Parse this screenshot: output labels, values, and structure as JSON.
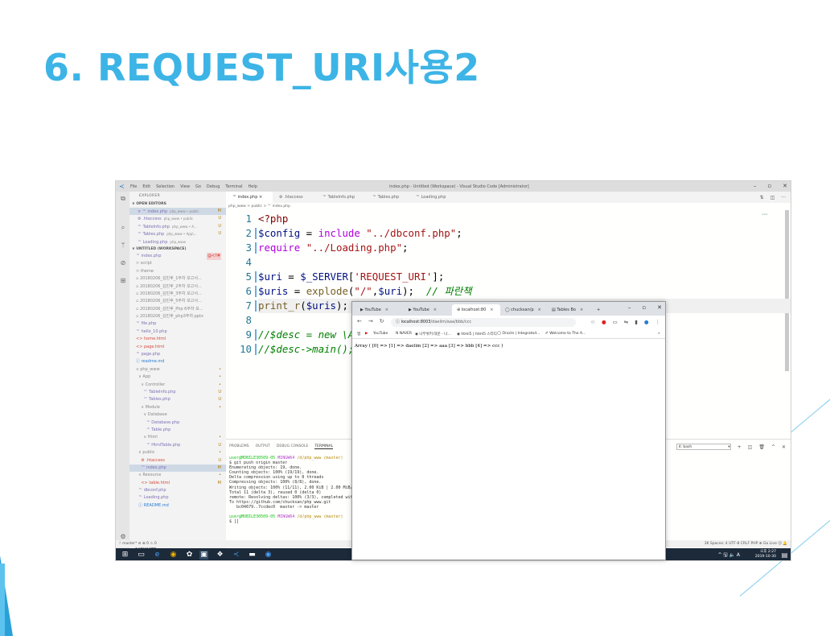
{
  "slide": {
    "title": "6. REQUEST_URI사용2"
  },
  "vscode": {
    "menu": [
      "File",
      "Edit",
      "Selection",
      "View",
      "Go",
      "Debug",
      "Terminal",
      "Help"
    ],
    "window_title": "index.php - Untitled (Workspace) - Visual Studio Code [Administrator]",
    "explorer_title": "EXPLORER",
    "open_editors_title": "∨ OPEN EDITORS",
    "open_editors": [
      {
        "name": "× ™ index.php",
        "hint": "php_www • public",
        "status": "M"
      },
      {
        "name": "⚙ .htaccess",
        "hint": "php_www • public",
        "status": "U"
      },
      {
        "name": "™ TableInfo.php",
        "hint": "php_www • A...",
        "status": "U"
      },
      {
        "name": "™ Tables.php",
        "hint": "php_www • App\\...",
        "status": "U"
      },
      {
        "name": "™ Loading.php",
        "hint": "php_www",
        "status": ""
      }
    ],
    "workspace_title": "∨ UNTITLED (WORKSPACE)",
    "tree": [
      {
        "name": "™ index.php",
        "status": "@<?#",
        "cls": "fi-php"
      },
      {
        "name": "> script",
        "status": "",
        "cls": "fi-dim"
      },
      {
        "name": "> theme",
        "status": "",
        "cls": "fi-dim"
      },
      {
        "name": "▫ 20180206_김민후_1주차 보고서...",
        "status": "",
        "cls": "fi-dim"
      },
      {
        "name": "▫ 20180206_김민후_2주차 보고서...",
        "status": "",
        "cls": "fi-dim"
      },
      {
        "name": "▫ 20180206_김민후_3주차 보고서...",
        "status": "",
        "cls": "fi-dim"
      },
      {
        "name": "▫ 20180206_김민후_5주차 보고서...",
        "status": "",
        "cls": "fi-dim"
      },
      {
        "name": "▫ 20180206_김민후_Php 6주차 보...",
        "status": "",
        "cls": "fi-dim"
      },
      {
        "name": "▫ 20180206_김민후_php3주차.pptx",
        "status": "",
        "cls": "fi-dim"
      },
      {
        "name": "™ file.php",
        "status": "",
        "cls": "fi-php"
      },
      {
        "name": "™ hello_10.php",
        "status": "",
        "cls": "fi-php"
      },
      {
        "name": "<> home.html",
        "status": "",
        "cls": "fi-git"
      },
      {
        "name": "<> page.html",
        "status": "",
        "cls": "fi-git"
      },
      {
        "name": "™ page.php",
        "status": "",
        "cls": "fi-php"
      },
      {
        "name": "ⓘ readme.md",
        "status": "",
        "cls": "fi-ht"
      },
      {
        "name": "∨ php_www",
        "status": "•",
        "cls": "fi-dim"
      },
      {
        "name": "  ∨ App",
        "status": "•",
        "cls": "fi-dim"
      },
      {
        "name": "    ∨ Controller",
        "status": "•",
        "cls": "fi-dim"
      },
      {
        "name": "      ™ TableInfo.php",
        "status": "U",
        "cls": "fi-php"
      },
      {
        "name": "      ™ Tables.php",
        "status": "U",
        "cls": "fi-php"
      },
      {
        "name": "    ∨ Module",
        "status": "•",
        "cls": "fi-dim"
      },
      {
        "name": "      ∨ Database",
        "status": "",
        "cls": "fi-dim"
      },
      {
        "name": "        ™ Database.php",
        "status": "",
        "cls": "fi-php"
      },
      {
        "name": "        ™ Table.php",
        "status": "",
        "cls": "fi-php"
      },
      {
        "name": "      ∨ Html",
        "status": "•",
        "cls": "fi-dim"
      },
      {
        "name": "        ™ HtmlTable.php",
        "status": "U",
        "cls": "fi-php"
      },
      {
        "name": "  ∨ public",
        "status": "•",
        "cls": "fi-dim"
      },
      {
        "name": "    ⚙ .htaccess",
        "status": "U",
        "cls": "fi-git"
      },
      {
        "name": "    ™ index.php",
        "status": "M",
        "cls": "fi-php",
        "sel": true
      },
      {
        "name": "  ∨ Resource",
        "status": "•",
        "cls": "fi-dim"
      },
      {
        "name": "    <> table.html",
        "status": "M",
        "cls": "fi-git"
      },
      {
        "name": "  ™ dbconf.php",
        "status": "",
        "cls": "fi-php"
      },
      {
        "name": "  ™ Loading.php",
        "status": "",
        "cls": "fi-php"
      },
      {
        "name": "  ⓘ README.md",
        "status": "",
        "cls": "fi-ht"
      }
    ],
    "outline_title": "> OUTLINE",
    "tabs": [
      "™ index.php ×",
      "⚙ .htaccess",
      "™ TableInfo.php",
      "™ Tables.php",
      "™ Loading.php"
    ],
    "breadcrumb": "php_www > public > ™ index.php",
    "code_lines": [
      {
        "n": "1",
        "parts": [
          [
            "k-tag",
            "<?php"
          ]
        ]
      },
      {
        "n": "2",
        "parts": [
          [
            "k-var",
            "$config"
          ],
          [
            "k-op",
            " = "
          ],
          [
            "k-kw",
            "include"
          ],
          [
            "k-op",
            " "
          ],
          [
            "k-str",
            "\"../dbconf.php\""
          ],
          [
            "k-op",
            ";"
          ]
        ]
      },
      {
        "n": "3",
        "parts": [
          [
            "k-kw",
            "require"
          ],
          [
            "k-op",
            " "
          ],
          [
            "k-str",
            "\"../Loading.php\""
          ],
          [
            "k-op",
            ";"
          ]
        ]
      },
      {
        "n": "4",
        "parts": []
      },
      {
        "n": "5",
        "parts": [
          [
            "k-var",
            "$uri"
          ],
          [
            "k-op",
            " = "
          ],
          [
            "k-var",
            "$_SERVER"
          ],
          [
            "k-op",
            "["
          ],
          [
            "k-str",
            "'REQUEST_URI'"
          ],
          [
            "k-op",
            "];"
          ]
        ]
      },
      {
        "n": "6",
        "parts": [
          [
            "k-var",
            "$uris"
          ],
          [
            "k-op",
            " = "
          ],
          [
            "k-fn",
            "explode"
          ],
          [
            "k-op",
            "("
          ],
          [
            "k-str",
            "\"/\""
          ],
          [
            "k-op",
            ","
          ],
          [
            "k-var",
            "$uri"
          ],
          [
            "k-op",
            ");  "
          ],
          [
            "k-cmt",
            "// 파란책"
          ]
        ]
      },
      {
        "n": "7",
        "parts": [
          [
            "k-fn",
            "print_r"
          ],
          [
            "k-op",
            "("
          ],
          [
            "k-var",
            "$uris"
          ],
          [
            "k-op",
            ");"
          ]
        ]
      },
      {
        "n": "8",
        "parts": []
      },
      {
        "n": "9",
        "parts": [
          [
            "k-cmt",
            "//$desc = new \\A"
          ]
        ]
      },
      {
        "n": "10",
        "parts": [
          [
            "k-cmt",
            "//$desc->main();"
          ]
        ]
      }
    ],
    "panel_tabs": [
      "PROBLEMS",
      "OUTPUT",
      "DEBUG CONSOLE",
      "TERMINAL"
    ],
    "terminal_select": "4: bash",
    "terminal_lines": [
      [
        [
          "g",
          "user@MOBILE30509-05"
        ],
        [
          "m",
          " MINGW64 "
        ],
        [
          "y",
          "/d/php_www (master)"
        ]
      ],
      [
        [
          "",
          "$ git push origin master"
        ]
      ],
      [
        [
          "",
          "Enumerating objects: 19, done."
        ]
      ],
      [
        [
          "",
          "Counting objects: 100% (19/19), done."
        ]
      ],
      [
        [
          "",
          "Delta compression using up to 8 threads"
        ]
      ],
      [
        [
          "",
          "Compressing objects: 100% (8/8), done."
        ]
      ],
      [
        [
          "",
          "Writing objects: 100% (11/11), 2.00 KiB | 2.00 MiB/"
        ]
      ],
      [
        [
          "",
          "Total 11 (delta 3), reused 0 (delta 0)"
        ]
      ],
      [
        [
          "",
          "remote: Resolving deltas: 100% (3/3), completed wit"
        ]
      ],
      [
        [
          "",
          "To https://github.com/chucksan/php_www.git"
        ]
      ],
      [
        [
          "",
          "   bc04679..7ccdec0  master -> master"
        ]
      ],
      [
        [
          "",
          ""
        ]
      ],
      [
        [
          "g",
          "user@MOBILE30509-05"
        ],
        [
          "m",
          " MINGW64 "
        ],
        [
          "y",
          "/d/php_www (master)"
        ]
      ],
      [
        [
          "",
          "$ []"
        ]
      ]
    ],
    "status_left": "ᚹ master*  ⊖  ⊗ 0 ⚠ 0",
    "status_right": "36   Spaces: 4   UTF-8   CRLF   PHP   ⊕ Go Live   ☺   🔔",
    "clock_time": "오후 2:27",
    "clock_date": "2019-10-30",
    "tray": "^ 🖫 🔈 A"
  },
  "chrome": {
    "tabs": [
      {
        "label": "▶ YouTube",
        "active": false
      },
      {
        "label": "▶ YouTube",
        "active": false
      },
      {
        "label": "⊕ localhost:80",
        "active": true
      },
      {
        "label": "◯ chucksan/p",
        "active": false
      },
      {
        "label": "▤ Tables Bo",
        "active": false
      }
    ],
    "new_tab": "+",
    "url_host": "localhost:8003",
    "url_path": "/daelim/aaa/bbb/ccc",
    "bookmarks": [
      "앱",
      "▶",
      "YouTube",
      "N NAVER",
      "◉ 나무위키:대문 - 나...",
      "◉ html5 | html5 스터디",
      "◯ Oracle | Integrated...",
      "✐ Welcome to The A...",
      "»"
    ],
    "output": "Array ( [0] => [1] => daelim [2] => aaa [3] => bbb [4] => ccc )"
  }
}
